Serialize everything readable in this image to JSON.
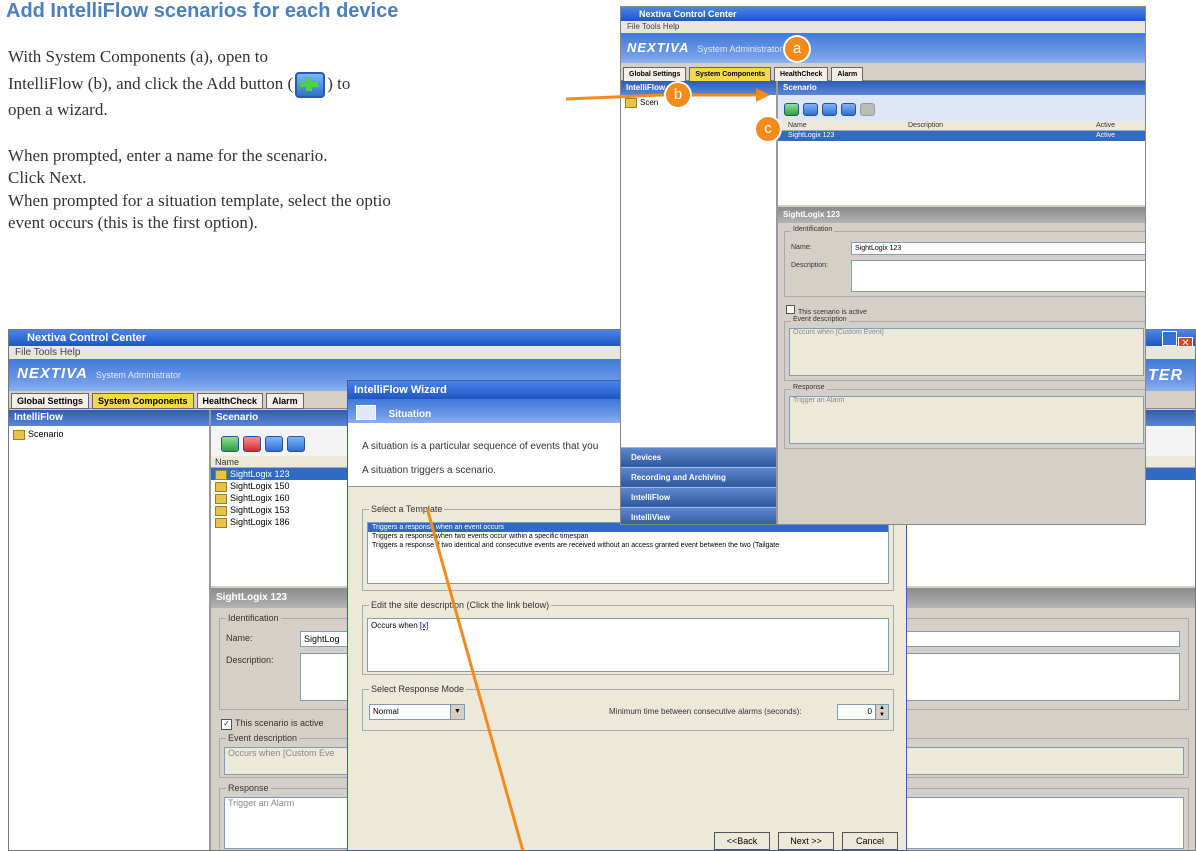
{
  "doc": {
    "title": "Add IntelliFlow scenarios for each device",
    "para1_a": "With System Components (a), open to",
    "para1_b": "IntelliFlow (b), and click the Add button (",
    "para1_c": ") to",
    "para1_d": "open a wizard.",
    "step1": "When prompted, enter a name for the scenario.",
    "step2": "Click Next.",
    "step3": "When prompted for a situation template, select the optio",
    "step4": "event occurs (this is the first option)."
  },
  "callouts": {
    "a": "a",
    "b": "b",
    "c": "c"
  },
  "back_window": {
    "title": "Nextiva Control Center",
    "menu": "File   Tools   Help",
    "brand": "NEXTIVA",
    "brand_sub": "System Administrator",
    "tabs": [
      "Global Settings",
      "System Components",
      "HealthCheck",
      "Alarm"
    ],
    "left_header": "IntelliFlow",
    "tree_root": "Scenario",
    "scenario_header": "Scenario",
    "columns": [
      "Name"
    ],
    "rows": [
      "SightLogix 123",
      "SightLogix 150",
      "SightLogix 160",
      "SightLogix 153",
      "SightLogix 186"
    ],
    "detail_header": "SightLogix 123",
    "identification": "Identification",
    "name_label": "Name:",
    "name_value": "SightLog",
    "description_label": "Description:",
    "active_label": "This scenario is active",
    "event_label": "Event description",
    "event_value": "Occurs when [Custom Eve",
    "response_label": "Response",
    "response_value": "Trigger an Alarm",
    "header_right": "TER"
  },
  "wizard": {
    "title": "IntelliFlow Wizard",
    "header": "Situation",
    "intro1": "A situation is a particular sequence of events that you",
    "intro2": "A situation triggers a scenario.",
    "template_legend": "Select a Template",
    "templates": [
      "Triggers a response when an event occurs",
      "Triggers a response when two events occur within a specific timespan",
      "Triggers a response if two identical and consecutive events are received without an access granted event between the two (Tailgate"
    ],
    "edit_legend": "Edit the site description (Click the link below)",
    "edit_value": "Occurs when ",
    "edit_link": "[x]",
    "mode_legend": "Select Response Mode",
    "mode_value": "Normal",
    "min_time_label": "Minimum time between consecutive alarms (seconds):",
    "min_time_value": "0",
    "back_btn": "<<Back",
    "next_btn": "Next >>",
    "cancel_btn": "Cancel"
  },
  "front_window": {
    "title": "Nextiva Control Center",
    "menu": "File   Tools   Help",
    "brand": "NEXTIVA",
    "brand_sub": "System Administrator",
    "tabs": [
      "Global Settings",
      "System Components",
      "HealthCheck",
      "Alarm"
    ],
    "left_header": "IntelliFlow",
    "tree_root": "Scen",
    "scenario_header": "Scenario",
    "columns": [
      "Name",
      "Description",
      "Active"
    ],
    "row_name": "SightLogix 123",
    "row_active": "Active",
    "detail_header": "SightLogix 123",
    "identification": "Identification",
    "name_label": "Name:",
    "name_value": "SightLogix 123",
    "description_label": "Description:",
    "active_label": "This scenario is active",
    "event_label": "Event description",
    "event_value": "Occurs when [Custom Event]",
    "response_label": "Response",
    "response_value": "Trigger an Alarm",
    "nav": [
      "Devices",
      "Recording and Archiving",
      "IntelliFlow",
      "IntelliView"
    ]
  },
  "colors": {
    "accent": "#f28a1c",
    "title": "#4a7fc1",
    "banner": "#3f7ad9"
  }
}
